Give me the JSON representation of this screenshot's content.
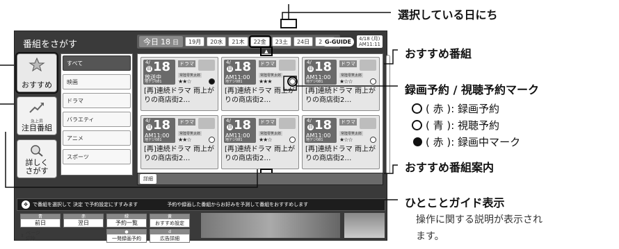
{
  "screen": {
    "title": "番組をさがす",
    "today": {
      "label": "今日",
      "date": "18",
      "weekday": "日"
    },
    "dates": [
      {
        "day": "19",
        "weekday": "月"
      },
      {
        "day": "20",
        "weekday": "水"
      },
      {
        "day": "21",
        "weekday": "木"
      },
      {
        "day": "22",
        "weekday": "金"
      },
      {
        "day": "23",
        "weekday": "土"
      },
      {
        "day": "24",
        "weekday": "日"
      },
      {
        "day": "25",
        "weekday": "月"
      }
    ],
    "logo": "G-GUIDE",
    "clock": "4/18 (月)\nAM11:11"
  },
  "tabs": [
    {
      "label": "おすすめ",
      "icon": "star-icon"
    },
    {
      "label": "注目番組",
      "sub": "急上昇",
      "icon": "trend-icon"
    },
    {
      "label": "詳しく\nさがす",
      "icon": "search-icon"
    }
  ],
  "genres": [
    "すべて",
    "映画",
    "ドラマ",
    "バラエティ",
    "アニメ",
    "スポーツ"
  ],
  "programs": [
    {
      "md": "4/",
      "day": "18",
      "weekday": "日",
      "time": "放送中",
      "ch": "地デジ081",
      "genre": "ドラマ",
      "cast": "常陸零笑太郎",
      "stars": "★★☆",
      "mark": "rec-live",
      "title": "[再]連続ドラマ 雨上がりの商店街2…"
    },
    {
      "md": "4/",
      "day": "18",
      "weekday": "日",
      "time": "AM11:00",
      "ch": "地デジ081",
      "genre": "ドラマ",
      "cast": "常陸零笑太郎",
      "stars": "★★★",
      "mark": "reserve",
      "title": "[再]連続ドラマ 雨上がりの商店街2…"
    },
    {
      "md": "4/",
      "day": "18",
      "weekday": "日",
      "time": "AM11:00",
      "ch": "地デジ081",
      "genre": "ドラマ",
      "cast": "常陸零笑太郎",
      "stars": "★☆☆",
      "mark": "reserve",
      "title": "[再]連続ドラマ 雨上がりの商店街2…"
    },
    {
      "md": "4/",
      "day": "18",
      "weekday": "日",
      "time": "AM11:00",
      "ch": "地デジ081",
      "genre": "ドラマ",
      "cast": "常陸零笑太郎",
      "stars": "★★☆",
      "mark": "reserve",
      "title": "[再]連続ドラマ 雨上がりの商店街2…"
    },
    {
      "md": "4/",
      "day": "18",
      "weekday": "日",
      "time": "AM11:00",
      "ch": "地デジ081",
      "genre": "ドラマ",
      "cast": "常陸零笑太郎",
      "stars": "★★☆",
      "mark": "reserve",
      "title": "[再]連続ドラマ 雨上がりの商店街2…"
    },
    {
      "md": "4/",
      "day": "18",
      "weekday": "日",
      "time": "AM11:00",
      "ch": "地デジ081",
      "genre": "ドラマ",
      "cast": "常陸零笑太郎",
      "stars": "★☆☆",
      "mark": "reserve",
      "title": "[再]連続ドラマ 雨上がりの商店街2…"
    }
  ],
  "detail_label": "詳細",
  "hint": {
    "left": "で番組を選択して  決定  で予約設定にすすみます",
    "right": "予約や録画した番組からお好みを予測して番組をおすすめします"
  },
  "color_buttons": [
    {
      "cap": "青",
      "label": "前日"
    },
    {
      "cap": "赤",
      "label": "翌日"
    },
    {
      "cap": "緑",
      "label": "予約一覧"
    },
    {
      "cap": "黄",
      "label": "おすすめ設定"
    }
  ],
  "bottom_buttons": {
    "page_switch": "ページ\n切換",
    "one_touch": "一発録画予約",
    "ad_detail": "広告詳細"
  },
  "callouts": {
    "selected_date": "選択している日にち",
    "recommended": "おすすめ番組",
    "reserve_mark": "録画予約 / 視聴予約マーク",
    "legend": [
      {
        "symbol": "clock-red-icon",
        "text": "( 赤 ): 録画予約"
      },
      {
        "symbol": "clock-blue-icon",
        "text": "( 青 ): 視聴予約"
      },
      {
        "symbol": "dot-red-icon",
        "text": "( 赤 ): 録画中マーク"
      }
    ],
    "guide_info": "おすすめ番組案内",
    "hint_display": "ひとことガイド表示",
    "hint_desc_1": "操作に関する説明が表示され",
    "hint_desc_2": "ます。"
  }
}
